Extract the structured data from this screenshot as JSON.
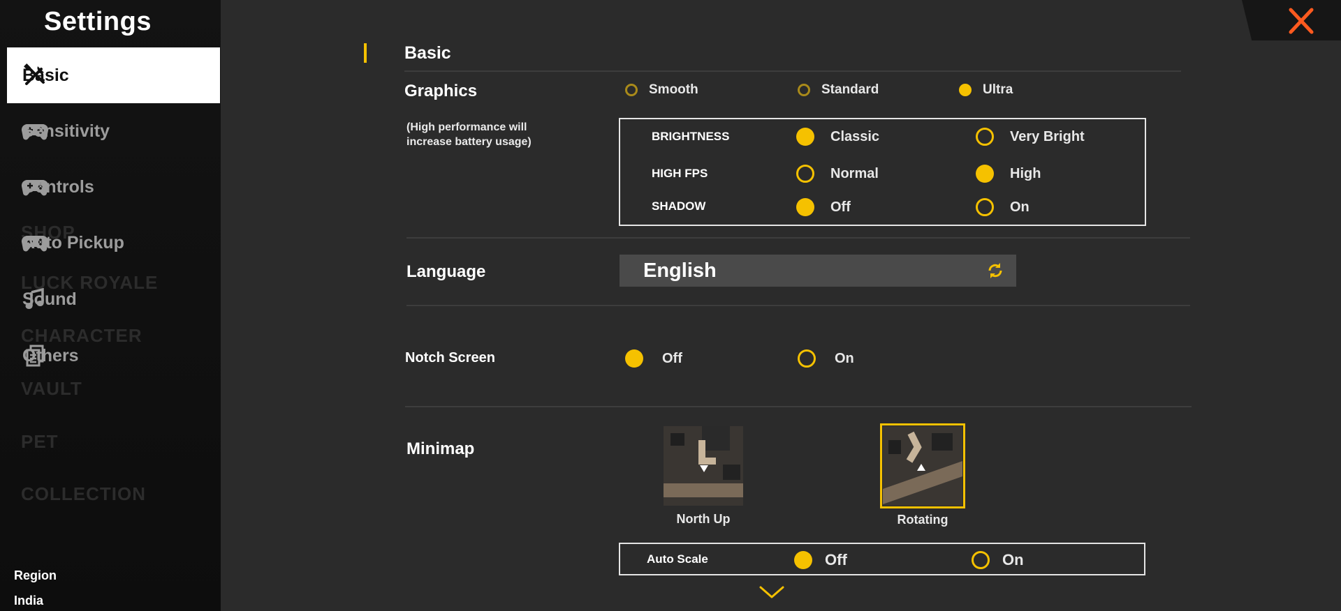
{
  "sidebar": {
    "title": "Settings",
    "items": [
      {
        "label": "Basic",
        "icon": "tools-icon"
      },
      {
        "label": "Sensitivity",
        "icon": "gamepad-icon"
      },
      {
        "label": "Controls",
        "icon": "gamepad-icon"
      },
      {
        "label": "Auto Pickup",
        "icon": "gamepad-icon"
      },
      {
        "label": "Sound",
        "icon": "music-note-icon"
      },
      {
        "label": "Others",
        "icon": "document-icon"
      }
    ],
    "region_label": "Region",
    "region_value": "India"
  },
  "background_menu": [
    "SHOP",
    "LUCK ROYALE",
    "CHARACTER",
    "VAULT",
    "PET",
    "COLLECTION"
  ],
  "basic": {
    "section_title": "Basic",
    "graphics": {
      "label": "Graphics",
      "note": "(High performance will increase battery usage)",
      "options": [
        "Smooth",
        "Standard",
        "Ultra"
      ],
      "selected": "Ultra"
    },
    "advanced": [
      {
        "label": "BRIGHTNESS",
        "options": [
          "Classic",
          "Very Bright"
        ],
        "selected": "Classic"
      },
      {
        "label": "HIGH FPS",
        "options": [
          "Normal",
          "High"
        ],
        "selected": "High"
      },
      {
        "label": "SHADOW",
        "options": [
          "Off",
          "On"
        ],
        "selected": "Off"
      }
    ],
    "language": {
      "label": "Language",
      "value": "English"
    },
    "notch_screen": {
      "label": "Notch Screen",
      "options": [
        "Off",
        "On"
      ],
      "selected": "Off"
    },
    "minimap": {
      "label": "Minimap",
      "options": [
        "North Up",
        "Rotating"
      ],
      "selected": "Rotating"
    },
    "auto_scale": {
      "label": "Auto Scale",
      "options": [
        "Off",
        "On"
      ],
      "selected": "Off"
    }
  },
  "colors": {
    "accent": "#f5c100",
    "panel": "#2b2b2b",
    "sidebar": "#111111",
    "close": "#ff5a1f"
  }
}
